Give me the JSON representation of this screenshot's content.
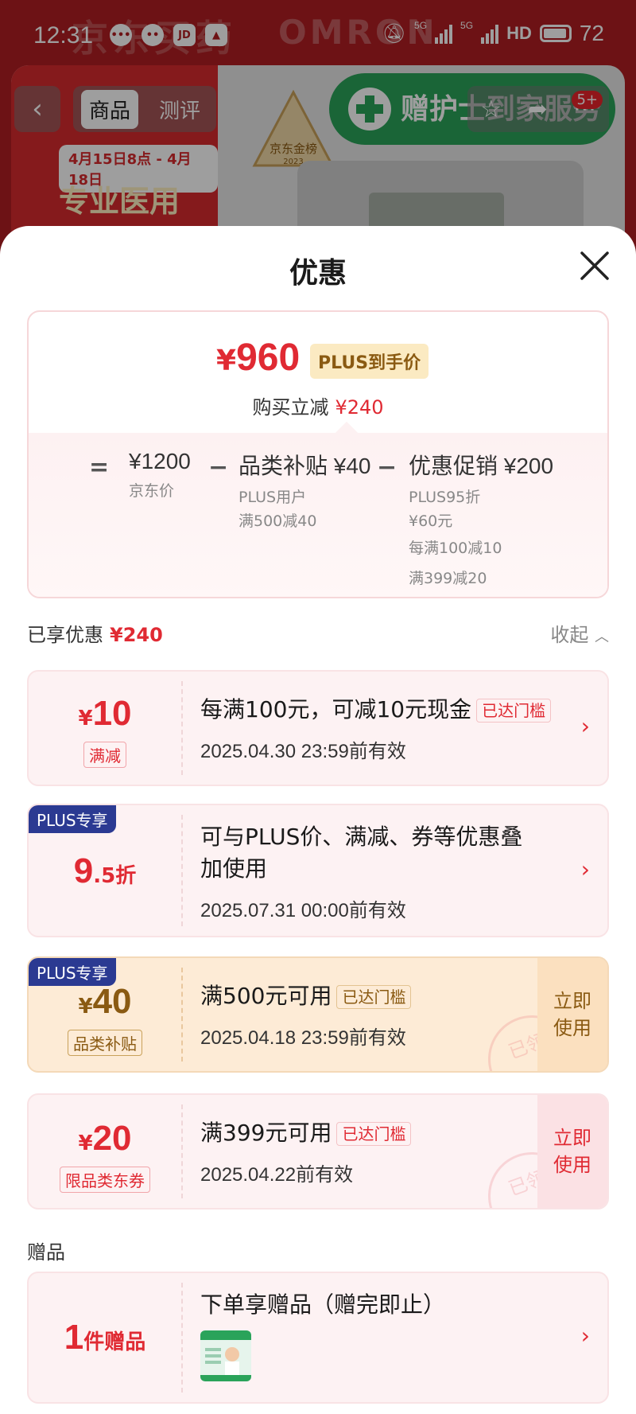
{
  "status_bar": {
    "time": "12:31",
    "app_icons": [
      "message-icon",
      "chat-icon",
      "jd-icon",
      "gallery-icon"
    ],
    "jd_label": "JD",
    "network": "5G",
    "hd_label": "HD",
    "battery": "72"
  },
  "background": {
    "brand_text": "京东买药",
    "omron_text": "OMRON",
    "promo_dates": "4月15日8点 - 4月18日",
    "promo_text": "专业医用",
    "award_text": "京东金榜",
    "award_year": "2023",
    "service_text": "赠护士到家服务"
  },
  "nav": {
    "back_icon": "chevron-left-icon",
    "tabs": [
      "商品",
      "测评"
    ],
    "active_tab": 0,
    "badge": "5+"
  },
  "sheet": {
    "title": "优惠",
    "close_icon": "close-icon"
  },
  "summary": {
    "currency": "¥",
    "final_price": "960",
    "plus_label": "PLUS到手价",
    "save_label": "购买立减",
    "save_amount": "¥240",
    "equals": "=",
    "minus": "−",
    "base_price": "¥1200",
    "base_label": "京东价",
    "subsidy_title": "品类补贴 ¥40",
    "subsidy_line1": "PLUS用户",
    "subsidy_line2": "满500减40",
    "promo_title": "优惠促销 ¥200",
    "promo_line1": "PLUS95折",
    "promo_line2": "¥60元",
    "promo_line3": "每满100减10",
    "promo_line4": "满399减20"
  },
  "enjoyed": {
    "label": "已享优惠",
    "amount": "¥240",
    "collapse_label": "收起"
  },
  "coupons": [
    {
      "currency": "¥",
      "amount": "10",
      "tag": "满减",
      "title": "每满100元，可减10元现金",
      "reach": "已达门槛",
      "date": "2025.04.30 23:59前有效"
    },
    {
      "plus_flag": "PLUS专享",
      "amount": "9",
      "amount_suffix": ".5折",
      "title_line1": "可与PLUS价、满减、券等优惠叠",
      "title_line2": "加使用",
      "date": "2025.07.31 00:00前有效"
    },
    {
      "plus_flag": "PLUS专享",
      "currency": "¥",
      "amount": "40",
      "tag": "品类补贴",
      "title": "满500元可用",
      "reach": "已达门槛",
      "date": "2025.04.18 23:59前有效",
      "use_label_1": "立即",
      "use_label_2": "使用",
      "stamp": "已领"
    },
    {
      "currency": "¥",
      "amount": "20",
      "tag": "限品类东券",
      "title": "满399元可用",
      "reach": "已达门槛",
      "date": "2025.04.22前有效",
      "use_label_1": "立即",
      "use_label_2": "使用",
      "stamp": "已领"
    }
  ],
  "gift": {
    "section_label": "赠品",
    "count": "1",
    "count_suffix": "件赠品",
    "title": "下单享赠品（赠完即止）"
  },
  "colors": {
    "accent_red": "#e02a33",
    "plus_blue": "#2b3a92",
    "plus_gold": "#8a5a12",
    "coupon_bg": "#fdf2f3",
    "subsidy_bg": "#fdebd6"
  }
}
